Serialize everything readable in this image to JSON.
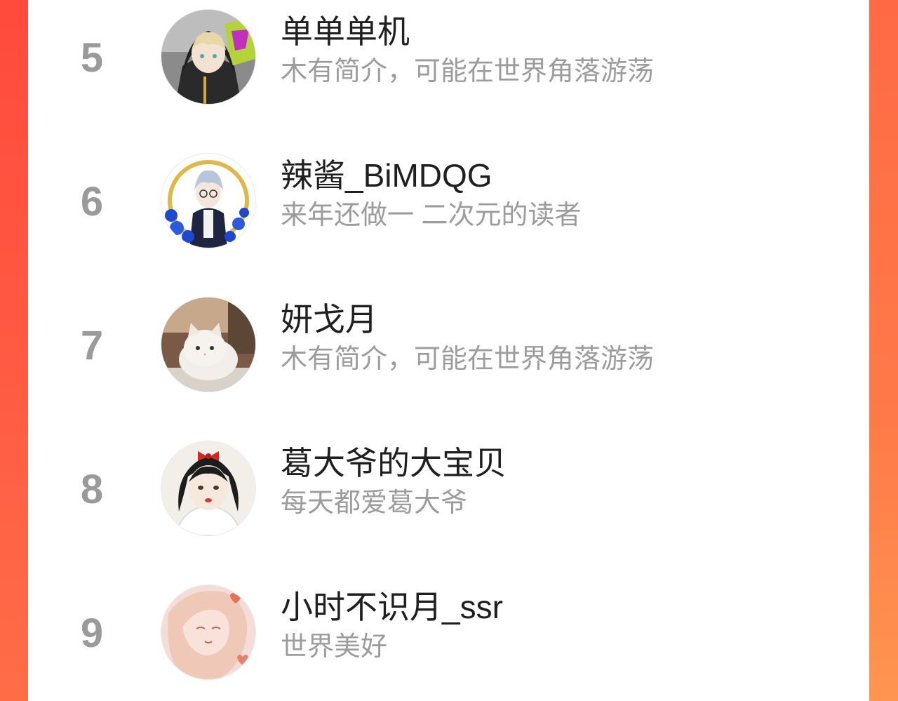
{
  "colors": {
    "accent": "#ff5a42",
    "panel": "#ffffff",
    "rank_text": "#9a9a9a",
    "name_text": "#1f1f1f",
    "bio_text": "#9c9c9c"
  },
  "list": {
    "items": [
      {
        "rank": "5",
        "name": "单单单机",
        "bio": "木有简介，可能在世界角落游荡",
        "avatar": "anime-boy-hood-avatar"
      },
      {
        "rank": "6",
        "name": "辣酱_BiMDQG",
        "bio": "来年还做一 二次元的读者",
        "avatar": "anime-boy-roses-avatar"
      },
      {
        "rank": "7",
        "name": "妍戈月",
        "bio": "木有简介，可能在世界角落游荡",
        "avatar": "white-cat-avatar"
      },
      {
        "rank": "8",
        "name": "葛大爷的大宝贝",
        "bio": "每天都爱葛大爷",
        "avatar": "snow-white-avatar"
      },
      {
        "rank": "9",
        "name": "小时不识月_ssr",
        "bio": "世界美好",
        "avatar": "pink-girl-avatar"
      }
    ]
  }
}
